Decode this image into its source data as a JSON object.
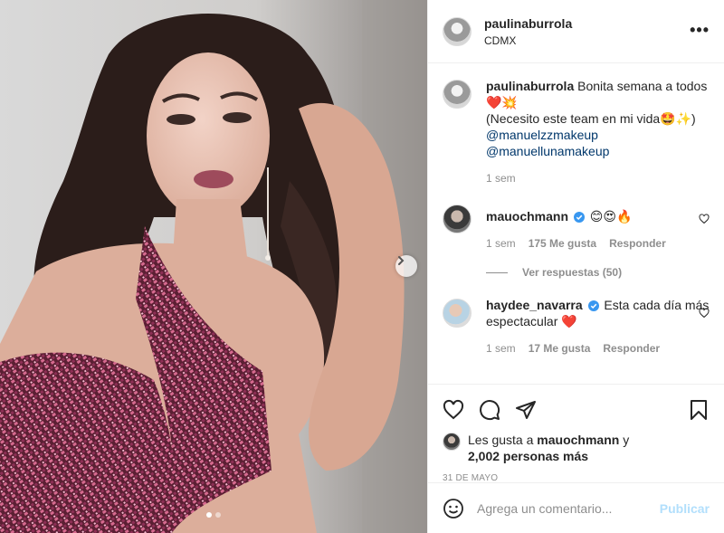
{
  "post": {
    "username": "paulinaburrola",
    "location": "CDMX",
    "more_label": "•••"
  },
  "photo": {
    "carousel_count": 2,
    "carousel_index": 0,
    "next_icon": "chevron-right-icon"
  },
  "caption": {
    "username": "paulinaburrola",
    "line1": "Bonita semana a todos",
    "line1_emoji": "❤️💥",
    "line2": "(Necesito este team en mi vida🤩✨)",
    "mention1": "@manuelzzmakeup",
    "mention2": "@manuellunamakeup",
    "time": "1 sem"
  },
  "comments": [
    {
      "username": "mauochmann",
      "text": "😊😍🔥",
      "time": "1 sem",
      "likes": "175 Me gusta",
      "reply": "Responder",
      "view_replies": "Ver respuestas (50)"
    },
    {
      "username": "haydee_navarra",
      "text": "Esta cada día más espectacular ❤️",
      "time": "1 sem",
      "likes": "17 Me gusta",
      "reply": "Responder"
    }
  ],
  "likes": {
    "prefix": "Les gusta a",
    "user": "mauochmann",
    "connector": "y",
    "others": "2,002 personas más"
  },
  "date": "31 DE MAYO",
  "add_comment": {
    "placeholder": "Agrega un comentario...",
    "post_label": "Publicar"
  },
  "colors": {
    "verified": "#3897f0",
    "link": "#00376b",
    "muted": "#8e8e8e",
    "post_disabled": "#b2dffc"
  }
}
